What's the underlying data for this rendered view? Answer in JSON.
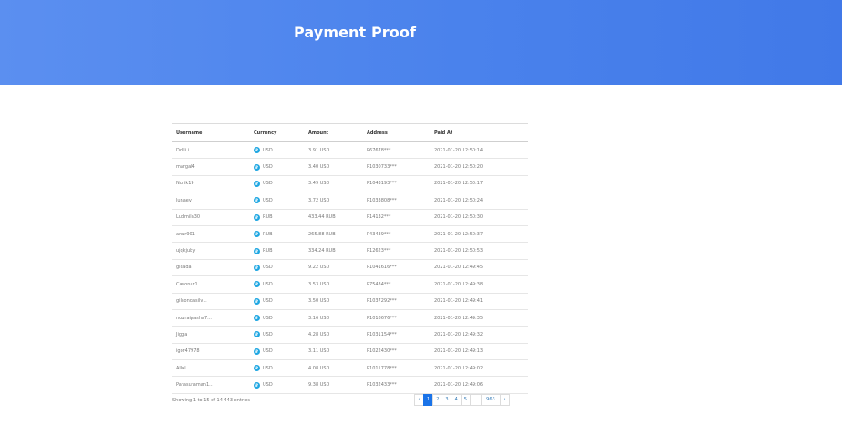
{
  "header": {
    "title": "Payment Proof"
  },
  "table": {
    "columns": [
      "Username",
      "Currency",
      "Amount",
      "Address",
      "Paid At"
    ],
    "rows": [
      {
        "username": "Dolli.i",
        "currency": "USD",
        "amount": "3.91 USD",
        "address": "P67678***",
        "paid_at": "2021-01-20 12:50:14"
      },
      {
        "username": "margal4",
        "currency": "USD",
        "amount": "3.40 USD",
        "address": "P1030733***",
        "paid_at": "2021-01-20 12:50:20"
      },
      {
        "username": "Nurik19",
        "currency": "USD",
        "amount": "3.49 USD",
        "address": "P1043193***",
        "paid_at": "2021-01-20 12:50:17"
      },
      {
        "username": "lunaev",
        "currency": "USD",
        "amount": "3.72 USD",
        "address": "P1033808***",
        "paid_at": "2021-01-20 12:50:24"
      },
      {
        "username": "Ludmila30",
        "currency": "RUB",
        "amount": "433.44 RUB",
        "address": "P14132***",
        "paid_at": "2021-01-20 12:50:30"
      },
      {
        "username": "anar901",
        "currency": "RUB",
        "amount": "265.88 RUB",
        "address": "P43439***",
        "paid_at": "2021-01-20 12:50:37"
      },
      {
        "username": "ujqkjuby",
        "currency": "RUB",
        "amount": "334.24 RUB",
        "address": "P12623***",
        "paid_at": "2021-01-20 12:50:53"
      },
      {
        "username": "gicada",
        "currency": "USD",
        "amount": "9.22 USD",
        "address": "P1041616***",
        "paid_at": "2021-01-20 12:49:45"
      },
      {
        "username": "Casonar1",
        "currency": "USD",
        "amount": "3.53 USD",
        "address": "P75434***",
        "paid_at": "2021-01-20 12:49:38"
      },
      {
        "username": "gilsondasilv...",
        "currency": "USD",
        "amount": "3.50 USD",
        "address": "P1037292***",
        "paid_at": "2021-01-20 12:49:41"
      },
      {
        "username": "nouraipasha7...",
        "currency": "USD",
        "amount": "3.16 USD",
        "address": "P1018676***",
        "paid_at": "2021-01-20 12:49:35"
      },
      {
        "username": "Jigga",
        "currency": "USD",
        "amount": "4.28 USD",
        "address": "P1031154***",
        "paid_at": "2021-01-20 12:49:32"
      },
      {
        "username": "igor47978",
        "currency": "USD",
        "amount": "3.11 USD",
        "address": "P1022430***",
        "paid_at": "2021-01-20 12:49:13"
      },
      {
        "username": "Allal",
        "currency": "USD",
        "amount": "4.08 USD",
        "address": "P1011778***",
        "paid_at": "2021-01-20 12:49:02"
      },
      {
        "username": "Parasuraman1...",
        "currency": "USD",
        "amount": "9.38 USD",
        "address": "P1032433***",
        "paid_at": "2021-01-20 12:49:06"
      }
    ]
  },
  "footer": {
    "info": "Showing 1 to 15 of 14,443 entries",
    "pagination": [
      "‹",
      "1",
      "2",
      "3",
      "4",
      "5",
      "…",
      "963",
      "›"
    ],
    "active_page": "1"
  },
  "colors": {
    "hero_start": "#5b8ff0",
    "hero_end": "#4179e8",
    "coin": "#1fa7e2",
    "active_page": "#1a73e8"
  },
  "icons": {
    "currency": "currency-coin-icon"
  }
}
